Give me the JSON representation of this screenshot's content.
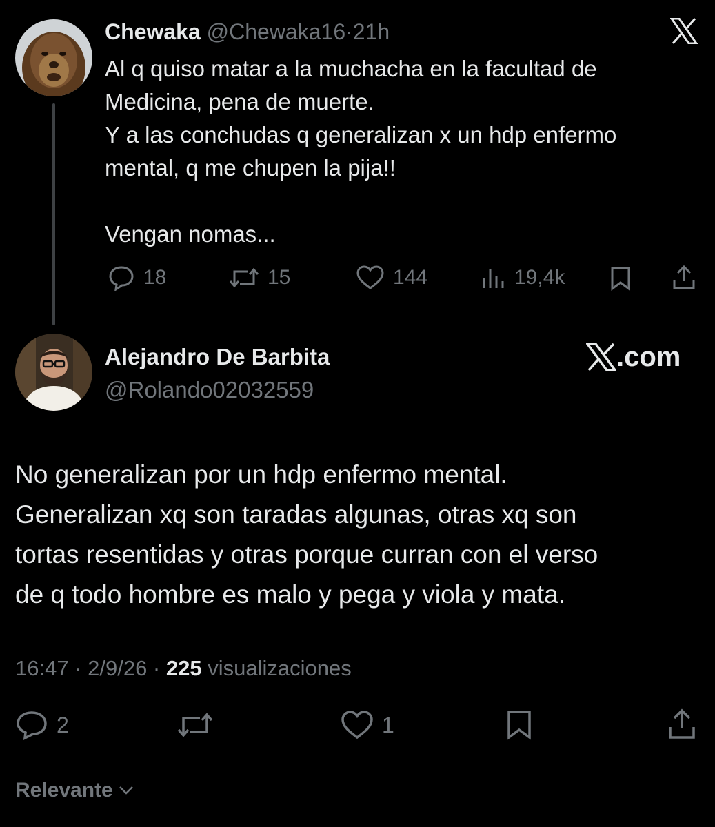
{
  "quoted": {
    "name": "Chewaka",
    "handle": "@Chewaka16",
    "sep": "·",
    "time": "21h",
    "avatar_icon": "wookiee-avatar",
    "text": "Al q quiso matar a la muchacha en la facultad de\nMedicina, pena de muerte.\nY a las conchudas q generalizan x un hdp enfermo\nmental, q me chupen la pija!!\n\nVengan nomas...",
    "replies": "18",
    "reposts": "15",
    "likes": "144",
    "views": "19,4k"
  },
  "main": {
    "name": "Alejandro De Barbita",
    "handle": "@Rolando02032559",
    "avatar_icon": "man-with-glasses-avatar",
    "text_lines": [
      "No generalizan por un hdp enfermo mental.",
      "Generalizan xq son taradas algunas, otras xq son",
      "tortas resentidas y otras porque curran con el verso",
      "de q todo hombre es malo y pega y viola y mata."
    ],
    "timestamp": "16:47 · 2/9/26 ·",
    "views_count": "225",
    "views_label": "visualizaciones",
    "replies": "2",
    "likes": "1"
  },
  "watermark": ".com",
  "sort_label": "Relevante",
  "colors": {
    "bg": "#000000",
    "text": "#e7e9ea",
    "muted": "#71767b",
    "line": "#3e4144"
  }
}
